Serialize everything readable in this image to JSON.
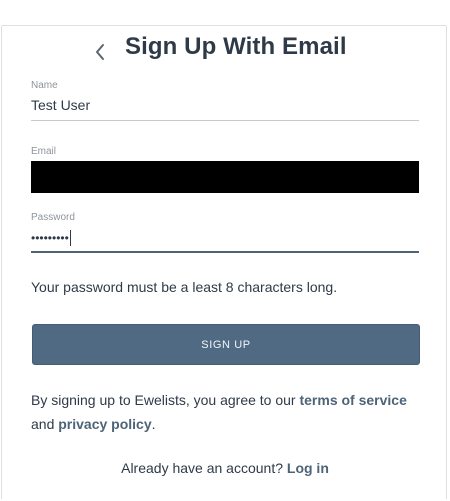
{
  "page": {
    "title": "Sign Up With Email"
  },
  "form": {
    "name": {
      "label": "Name",
      "value": "Test User"
    },
    "email": {
      "label": "Email",
      "value": ""
    },
    "password": {
      "label": "Password",
      "masked_value": "•••••••••"
    },
    "hint": "Your password must be a least 8 characters long.",
    "submit_label": "SIGN UP"
  },
  "terms": {
    "prefix": "By signing up to Ewelists, you agree to our ",
    "tos_link": "terms of service",
    "middle": " and ",
    "privacy_link": "privacy policy",
    "suffix": "."
  },
  "login": {
    "prompt": "Already have an account? ",
    "link": "Log in"
  },
  "colors": {
    "accent": "#4d6478",
    "button": "#4f6a82",
    "text": "#2f3a48",
    "label": "#8e949b"
  },
  "icons": {
    "back": "chevron-left-icon"
  }
}
